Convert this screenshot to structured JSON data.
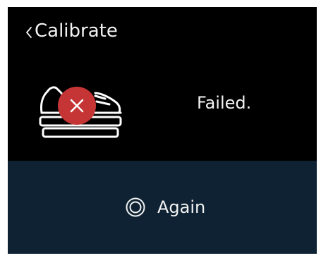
{
  "header": {
    "title": "Calibrate",
    "back_icon": "chevron-left-icon"
  },
  "status": {
    "text": "Failed.",
    "illustration_icon": "shoe-on-scale-icon",
    "badge_icon": "error-x-icon"
  },
  "action": {
    "label": "Again",
    "icon": "radio-target-icon"
  },
  "colors": {
    "background": "#000000",
    "button_background": "#0e2233",
    "text": "#f2f2f2",
    "error_badge": "#c63535"
  }
}
